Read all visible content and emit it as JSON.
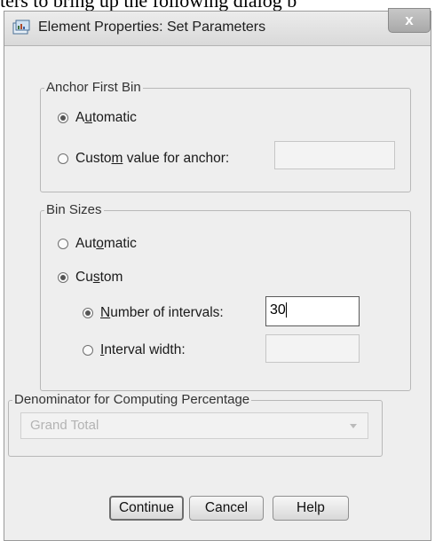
{
  "document_fragment": "ters to bring up the following dialog b",
  "dialog": {
    "title": "Element Properties: Set Parameters",
    "close_glyph": "x"
  },
  "anchor_first_bin": {
    "legend": "Anchor First Bin",
    "automatic": {
      "pre": "A",
      "ul": "u",
      "post": "tomatic",
      "selected": true
    },
    "custom": {
      "pre": "Custo",
      "ul": "m",
      "post": " value for anchor:",
      "selected": false
    },
    "custom_value": ""
  },
  "bin_sizes": {
    "legend": "Bin Sizes",
    "automatic": {
      "pre": "Aut",
      "ul": "o",
      "post": "matic",
      "selected": false
    },
    "custom": {
      "pre": "Cu",
      "ul": "s",
      "post": "tom",
      "selected": true
    },
    "number_of_intervals": {
      "pre": "",
      "ul": "N",
      "post": "umber of intervals:",
      "selected": true,
      "value": "30"
    },
    "interval_width": {
      "pre": "",
      "ul": "I",
      "post": "nterval width:",
      "selected": false,
      "value": ""
    }
  },
  "denominator": {
    "legend": "Denominator for Computing Percentage",
    "selected": "Grand Total"
  },
  "buttons": {
    "continue": "Continue",
    "cancel": "Cancel",
    "help": "Help"
  }
}
